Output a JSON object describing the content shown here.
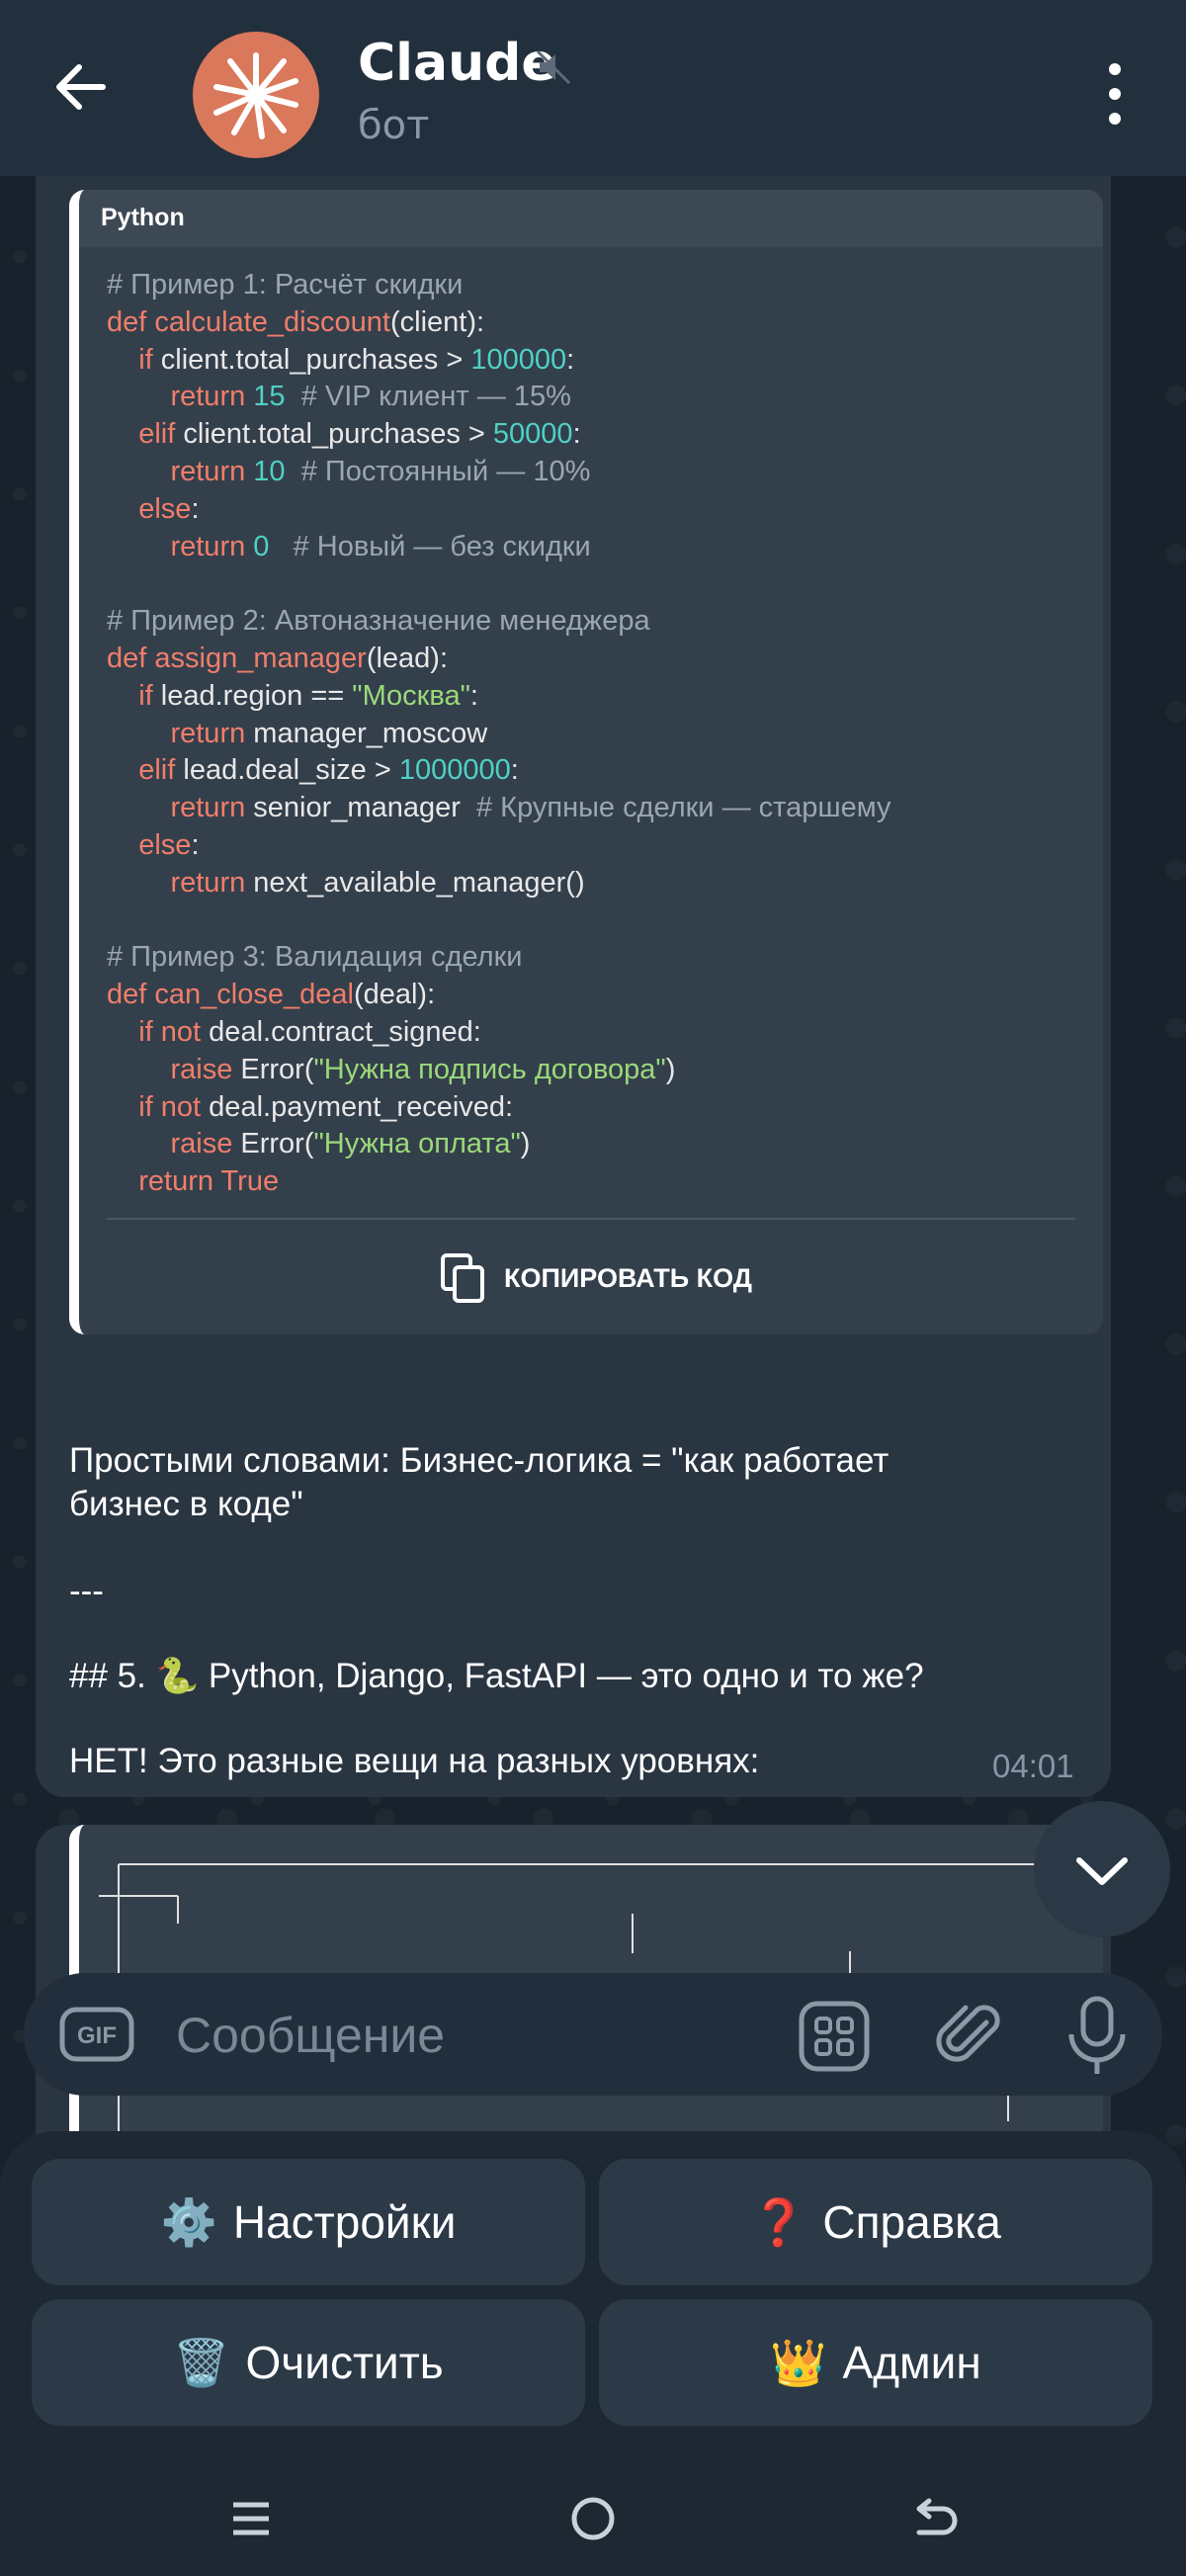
{
  "header": {
    "title": "Claude",
    "subtitle": "бот",
    "back_icon": "arrow-left-icon",
    "mute_icon": "speaker-muted-icon",
    "menu_icon": "three-dots-vertical-icon",
    "avatar_icon": "claude-starburst-icon",
    "avatar_color": "#d9785a"
  },
  "message": {
    "code_block": {
      "language": "Python",
      "copy_label": "КОПИРОВАТЬ КОД",
      "copy_icon": "copy-icon",
      "lines": [
        "# Пример 1: Расчёт скидки",
        "def calculate_discount(client):",
        "    if client.total_purchases > 100000:",
        "        return 15  # VIP клиент — 15%",
        "    elif client.total_purchases > 50000:",
        "        return 10  # Постоянный — 10%",
        "    else:",
        "        return 0   # Новый — без скидки",
        "",
        "# Пример 2: Автоназначение менеджера",
        "def assign_manager(lead):",
        "    if lead.region == \"Москва\":",
        "        return manager_moscow",
        "    elif lead.deal_size > 1000000:",
        "        return senior_manager  # Крупные сделки — старшему",
        "    else:",
        "        return next_available_manager()",
        "",
        "# Пример 3: Валидация сделки",
        "def can_close_deal(deal):",
        "    if not deal.contract_signed:",
        "        raise Error(\"Нужна подпись договора\")",
        "    if not deal.payment_received:",
        "        raise Error(\"Нужна оплата\")",
        "    return True"
      ]
    },
    "paragraphs": [
      "Простыми словами: Бизнес-логика = \"как работает",
      "бизнес в коде\"",
      "---",
      "## 5. 🐍 Python, Django, FastAPI — это одно и то же?",
      "НЕТ! Это разные вещи на разных уровнях:"
    ],
    "time": "04:01"
  },
  "scroll_down_icon": "chevron-down-icon",
  "input": {
    "placeholder": "Сообщение",
    "value": "",
    "gif_label": "GIF",
    "bot_menu_icon": "grid-icon",
    "attach_icon": "paperclip-icon",
    "mic_icon": "microphone-icon"
  },
  "keyboard": {
    "buttons": [
      {
        "emoji": "⚙️",
        "label": "Настройки"
      },
      {
        "emoji": "❓",
        "label": "Справка"
      },
      {
        "emoji": "🗑️",
        "label": "Очистить"
      },
      {
        "emoji": "👑",
        "label": "Админ"
      }
    ]
  },
  "nav": {
    "recents_icon": "recents-icon",
    "home_icon": "home-circle-icon",
    "back_icon": "back-arrow-icon"
  }
}
